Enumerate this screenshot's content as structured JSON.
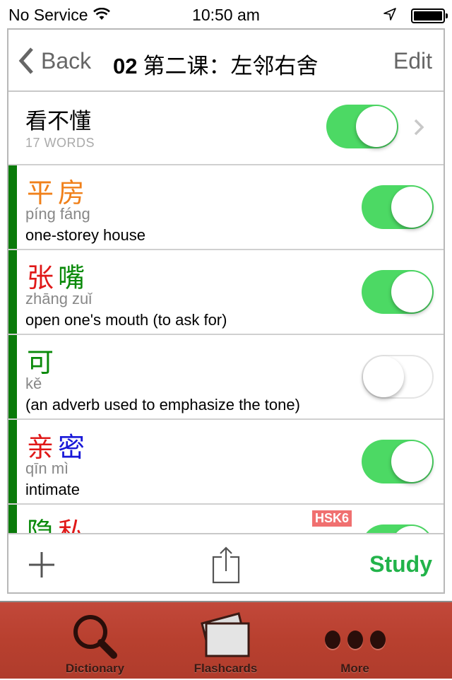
{
  "status_bar": {
    "carrier": "No Service",
    "time": "10:50 am",
    "icons": [
      "wifi-icon",
      "location-arrow-icon",
      "battery-icon"
    ],
    "battery_level": 1.0
  },
  "nav": {
    "back_label": "Back",
    "title_number": "02",
    "title_text": "第二课：左邻右舍",
    "edit_label": "Edit"
  },
  "group": {
    "title": "看不懂",
    "count": "17 WORDS",
    "enabled": true
  },
  "words": [
    {
      "chars": [
        {
          "c": "平",
          "color": "#f0801a"
        },
        {
          "c": "房",
          "color": "#f0801a"
        }
      ],
      "pinyin": "píng fáng",
      "meaning": "one-storey house",
      "enabled": true
    },
    {
      "chars": [
        {
          "c": "张",
          "color": "#e01818"
        },
        {
          "c": "嘴",
          "color": "#0a8a0a"
        }
      ],
      "pinyin": "zhāng zuǐ",
      "meaning": "open one's mouth (to ask for)",
      "enabled": true
    },
    {
      "chars": [
        {
          "c": "可",
          "color": "#0a8a0a"
        }
      ],
      "pinyin": "kě",
      "meaning": "(an adverb used to emphasize the tone)",
      "enabled": false
    },
    {
      "chars": [
        {
          "c": "亲",
          "color": "#e01818"
        },
        {
          "c": "密",
          "color": "#1818d8"
        }
      ],
      "pinyin": "qīn mì",
      "meaning": "intimate",
      "enabled": true
    },
    {
      "chars": [
        {
          "c": "隐",
          "color": "#0a8a0a"
        },
        {
          "c": "私",
          "color": "#e01818"
        }
      ],
      "pinyin": "",
      "meaning": "",
      "badge": "HSK6",
      "enabled": true
    }
  ],
  "toolbar": {
    "add_icon": "plus-icon",
    "share_icon": "share-icon",
    "study_label": "Study"
  },
  "tabs": [
    {
      "label": "Dictionary",
      "icon": "magnifier-icon"
    },
    {
      "label": "Flashcards",
      "icon": "flashcards-icon"
    },
    {
      "label": "More",
      "icon": "more-dots-icon"
    }
  ],
  "colors": {
    "toggle_on": "#4cd964",
    "study": "#22b34a",
    "word_bar": "#0a7a0a",
    "tabbar": "#b8402f",
    "hsk_badge": "#f07070"
  }
}
